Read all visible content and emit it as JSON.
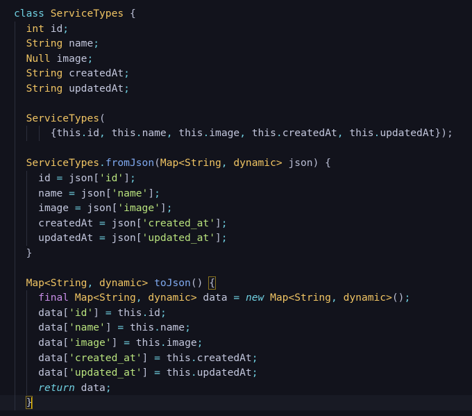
{
  "editor": {
    "language": "dart",
    "current_line": 27,
    "lines": [
      [
        [
          "class",
          "k"
        ],
        [
          " ",
          "v"
        ],
        [
          "ServiceTypes",
          "t"
        ],
        [
          " {",
          "b"
        ]
      ],
      [
        [
          "int",
          "t"
        ],
        [
          " id",
          "v"
        ],
        [
          ";",
          "p"
        ]
      ],
      [
        [
          "String",
          "t"
        ],
        [
          " name",
          "v"
        ],
        [
          ";",
          "p"
        ]
      ],
      [
        [
          "Null",
          "t"
        ],
        [
          " image",
          "v"
        ],
        [
          ";",
          "p"
        ]
      ],
      [
        [
          "String",
          "t"
        ],
        [
          " createdAt",
          "v"
        ],
        [
          ";",
          "p"
        ]
      ],
      [
        [
          "String",
          "t"
        ],
        [
          " updatedAt",
          "v"
        ],
        [
          ";",
          "p"
        ]
      ],
      [],
      [
        [
          "ServiceTypes",
          "t"
        ],
        [
          "(",
          "b"
        ]
      ],
      [
        [
          "{this",
          "v"
        ],
        [
          ".",
          "p"
        ],
        [
          "id",
          "v"
        ],
        [
          ", ",
          "p"
        ],
        [
          "this",
          "v"
        ],
        [
          ".",
          "p"
        ],
        [
          "name",
          "v"
        ],
        [
          ", ",
          "p"
        ],
        [
          "this",
          "v"
        ],
        [
          ".",
          "p"
        ],
        [
          "image",
          "v"
        ],
        [
          ", ",
          "p"
        ],
        [
          "this",
          "v"
        ],
        [
          ".",
          "p"
        ],
        [
          "createdAt",
          "v"
        ],
        [
          ", ",
          "p"
        ],
        [
          "this",
          "v"
        ],
        [
          ".",
          "p"
        ],
        [
          "updatedAt",
          "v"
        ],
        [
          "});",
          "b"
        ]
      ],
      [],
      [
        [
          "ServiceTypes",
          "t"
        ],
        [
          ".",
          "p"
        ],
        [
          "fromJson",
          "f"
        ],
        [
          "(",
          "b"
        ],
        [
          "Map<String",
          "t"
        ],
        [
          ", ",
          "p"
        ],
        [
          "dynamic>",
          "t"
        ],
        [
          " json) {",
          "b"
        ]
      ],
      [
        [
          "id ",
          "v"
        ],
        [
          "=",
          "p"
        ],
        [
          " json[",
          "v"
        ],
        [
          "'id'",
          "s"
        ],
        [
          "]",
          "b"
        ],
        [
          ";",
          "p"
        ]
      ],
      [
        [
          "name ",
          "v"
        ],
        [
          "=",
          "p"
        ],
        [
          " json[",
          "v"
        ],
        [
          "'name'",
          "s"
        ],
        [
          "]",
          "b"
        ],
        [
          ";",
          "p"
        ]
      ],
      [
        [
          "image ",
          "v"
        ],
        [
          "=",
          "p"
        ],
        [
          " json[",
          "v"
        ],
        [
          "'image'",
          "s"
        ],
        [
          "]",
          "b"
        ],
        [
          ";",
          "p"
        ]
      ],
      [
        [
          "createdAt ",
          "v"
        ],
        [
          "=",
          "p"
        ],
        [
          " json[",
          "v"
        ],
        [
          "'created_at'",
          "s"
        ],
        [
          "]",
          "b"
        ],
        [
          ";",
          "p"
        ]
      ],
      [
        [
          "updatedAt ",
          "v"
        ],
        [
          "=",
          "p"
        ],
        [
          " json[",
          "v"
        ],
        [
          "'updated_at'",
          "s"
        ],
        [
          "]",
          "b"
        ],
        [
          ";",
          "p"
        ]
      ],
      [
        [
          "}",
          "b"
        ]
      ],
      [],
      [
        [
          "Map<String",
          "t"
        ],
        [
          ", ",
          "p"
        ],
        [
          "dynamic>",
          "t"
        ],
        [
          " ",
          "v"
        ],
        [
          "toJson",
          "f"
        ],
        [
          "() ",
          "b"
        ],
        [
          "{",
          "match"
        ]
      ],
      [
        [
          "final",
          "m"
        ],
        [
          " ",
          "v"
        ],
        [
          "Map<String",
          "t"
        ],
        [
          ", ",
          "p"
        ],
        [
          "dynamic>",
          "t"
        ],
        [
          " data ",
          "v"
        ],
        [
          "=",
          "p"
        ],
        [
          " ",
          "v"
        ],
        [
          "new",
          "i"
        ],
        [
          " ",
          "v"
        ],
        [
          "Map<String",
          "t"
        ],
        [
          ", ",
          "p"
        ],
        [
          "dynamic>",
          "t"
        ],
        [
          "()",
          "b"
        ],
        [
          ";",
          "p"
        ]
      ],
      [
        [
          "data[",
          "v"
        ],
        [
          "'id'",
          "s"
        ],
        [
          "] ",
          "b"
        ],
        [
          "=",
          "p"
        ],
        [
          " this",
          "v"
        ],
        [
          ".",
          "p"
        ],
        [
          "id",
          "v"
        ],
        [
          ";",
          "p"
        ]
      ],
      [
        [
          "data[",
          "v"
        ],
        [
          "'name'",
          "s"
        ],
        [
          "] ",
          "b"
        ],
        [
          "=",
          "p"
        ],
        [
          " this",
          "v"
        ],
        [
          ".",
          "p"
        ],
        [
          "name",
          "v"
        ],
        [
          ";",
          "p"
        ]
      ],
      [
        [
          "data[",
          "v"
        ],
        [
          "'image'",
          "s"
        ],
        [
          "] ",
          "b"
        ],
        [
          "=",
          "p"
        ],
        [
          " this",
          "v"
        ],
        [
          ".",
          "p"
        ],
        [
          "image",
          "v"
        ],
        [
          ";",
          "p"
        ]
      ],
      [
        [
          "data[",
          "v"
        ],
        [
          "'created_at'",
          "s"
        ],
        [
          "] ",
          "b"
        ],
        [
          "=",
          "p"
        ],
        [
          " this",
          "v"
        ],
        [
          ".",
          "p"
        ],
        [
          "createdAt",
          "v"
        ],
        [
          ";",
          "p"
        ]
      ],
      [
        [
          "data[",
          "v"
        ],
        [
          "'updated_at'",
          "s"
        ],
        [
          "] ",
          "b"
        ],
        [
          "=",
          "p"
        ],
        [
          " this",
          "v"
        ],
        [
          ".",
          "p"
        ],
        [
          "updatedAt",
          "v"
        ],
        [
          ";",
          "p"
        ]
      ],
      [
        [
          "return",
          "i"
        ],
        [
          " data",
          "v"
        ],
        [
          ";",
          "p"
        ]
      ],
      [
        [
          "}",
          "match"
        ]
      ]
    ],
    "indents": [
      0,
      2,
      2,
      2,
      2,
      2,
      0,
      2,
      6,
      0,
      2,
      4,
      4,
      4,
      4,
      4,
      2,
      0,
      2,
      4,
      4,
      4,
      4,
      4,
      4,
      4,
      2
    ]
  }
}
